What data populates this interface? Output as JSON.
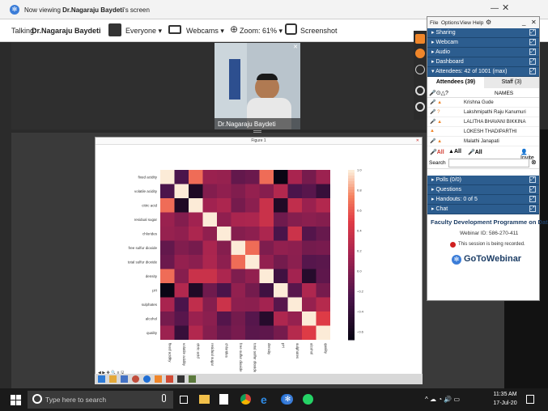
{
  "topbar": {
    "viewing_prefix": "Now viewing ",
    "viewing_name": "Dr.Nagaraju Baydeti",
    "viewing_suffix": "'s screen"
  },
  "toolbar": {
    "talking_label": "Talking:",
    "talking_name": "Dr.Nagaraju Baydeti",
    "everyone_label": "Everyone ▾",
    "webcams_label": "Webcams ▾",
    "zoom_label": "Zoom: 61% ▾",
    "screenshot_label": "Screenshot"
  },
  "video": {
    "presenter_name": "Dr.Nagaraju Baydeti"
  },
  "figure": {
    "title": "Figure 1"
  },
  "panel": {
    "menu": [
      "File",
      "Options",
      "View",
      "Help"
    ],
    "sections_top": [
      "Sharing",
      "Webcam",
      "Audio",
      "Dashboard"
    ],
    "attendees_header": "Attendees: 42 of 1001 (max)",
    "tab_attendees": "Attendees (39)",
    "tab_staff": "Staff (3)",
    "names_header": "NAMES",
    "attendees": [
      "Krishna Gude",
      "Lakshmipathi Raju Kanumuri",
      "LALITHA BHAVANI BIKKINA",
      "LOKESH THADIPARTHI",
      "Malathi Janapati"
    ],
    "all_btn_1": "All",
    "all_btn_2": "All",
    "all_btn_3": "All",
    "invite_label": "Invite",
    "search_label": "Search",
    "sections_bottom": [
      "Polls (0/0)",
      "Questions",
      "Handouts: 0 of 5",
      "Chat"
    ],
    "webinar_title": "Faculty Development Programme on Data...",
    "webinar_id": "Webinar ID: 586-270-411",
    "recording_text": "This session is being recorded.",
    "brand": "GoToWebinar"
  },
  "taskbar": {
    "search_placeholder": "Type here to search",
    "time": "11:35 AM",
    "date": "17-Jul-20"
  },
  "colors": {
    "panel_header": "#2c5d8f",
    "accent_orange": "#f0862a"
  },
  "chart_data": {
    "type": "heatmap",
    "rows": [
      "fixed acidity",
      "volatile acidity",
      "citric acid",
      "residual sugar",
      "chlorides",
      "free sulfur dioxide",
      "total sulfur dioxide",
      "density",
      "pH",
      "sulphates",
      "alcohol",
      "quality"
    ],
    "cols": [
      "fixed acidity",
      "volatile acidity",
      "citric acid",
      "residual sugar",
      "chlorides",
      "free sulfur dioxide",
      "total sulfur dioxide",
      "density",
      "pH",
      "sulphates",
      "alcohol",
      "quality"
    ],
    "values": [
      [
        1.0,
        -0.26,
        0.67,
        0.11,
        0.09,
        -0.15,
        -0.11,
        0.67,
        -0.68,
        0.18,
        -0.06,
        0.12
      ],
      [
        -0.26,
        1.0,
        -0.55,
        0.0,
        0.06,
        -0.01,
        0.08,
        0.02,
        0.23,
        -0.26,
        -0.2,
        -0.39
      ],
      [
        0.67,
        -0.55,
        1.0,
        0.14,
        0.2,
        -0.06,
        0.04,
        0.36,
        -0.54,
        0.31,
        0.11,
        0.23
      ],
      [
        0.11,
        0.0,
        0.14,
        1.0,
        0.06,
        0.19,
        0.2,
        0.36,
        -0.09,
        0.01,
        0.04,
        0.01
      ],
      [
        0.09,
        0.06,
        0.2,
        0.06,
        1.0,
        0.01,
        0.05,
        0.2,
        -0.27,
        0.37,
        -0.22,
        -0.13
      ],
      [
        -0.15,
        -0.01,
        -0.06,
        0.19,
        0.01,
        1.0,
        0.67,
        -0.02,
        0.07,
        0.05,
        -0.07,
        -0.05
      ],
      [
        -0.11,
        0.08,
        0.04,
        0.2,
        0.05,
        0.67,
        1.0,
        0.07,
        -0.07,
        0.04,
        -0.21,
        -0.19
      ],
      [
        0.67,
        0.02,
        0.36,
        0.36,
        0.2,
        -0.02,
        0.07,
        1.0,
        -0.34,
        0.15,
        -0.5,
        -0.17
      ],
      [
        -0.68,
        0.23,
        -0.54,
        -0.09,
        -0.27,
        0.07,
        -0.07,
        -0.34,
        1.0,
        -0.2,
        0.21,
        -0.06
      ],
      [
        0.18,
        -0.26,
        0.31,
        0.01,
        0.37,
        0.05,
        0.04,
        0.15,
        -0.2,
        1.0,
        0.09,
        0.25
      ],
      [
        -0.06,
        -0.2,
        0.11,
        0.04,
        -0.22,
        -0.07,
        -0.21,
        -0.5,
        0.21,
        0.09,
        1.0,
        0.48
      ],
      [
        0.12,
        -0.39,
        0.23,
        0.01,
        -0.13,
        -0.05,
        -0.19,
        -0.17,
        -0.06,
        0.25,
        0.48,
        1.0
      ]
    ],
    "colorbar_ticks": [
      "1.0",
      "0.8",
      "0.6",
      "0.4",
      "0.2",
      "0.0",
      "−0.2",
      "−0.4",
      "−0.6"
    ],
    "vmin": -0.68,
    "vmax": 1.0
  }
}
